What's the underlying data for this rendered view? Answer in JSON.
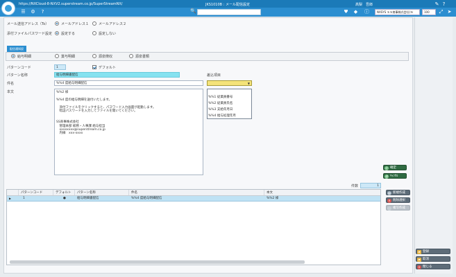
{
  "header": {
    "url": "https://NXCloud-8-NXV2.superstream.co.jp/SuperStreamNX/",
    "title": "JKS1010B : メール配信設定",
    "user": "高梨　吾郎",
    "company": "NXSYS ＳＳ商事株式会社(Ｎ",
    "zoom": "100"
  },
  "form": {
    "mail_to_label": "メール送信アドレス（To）",
    "mail_to_options": [
      "メールアドレス１",
      "メールアドレス２"
    ],
    "password_label": "添付ファイルパスワード設定",
    "password_options": [
      "設定する",
      "設定しない"
    ],
    "section_tag": "配信通知設",
    "delivery_types": [
      "給与明細",
      "賞与明細",
      "源泉徴収",
      "源泉書類"
    ],
    "pattern_code_label": "パターンコード",
    "pattern_code_value": "1",
    "default_label": "デフォルト",
    "pattern_name_label": "パターン名称",
    "pattern_name_value": "給与明細書配信",
    "subject_label": "件名",
    "subject_value": "%%4 度給与明細配信",
    "insert_item_label": "差込項目",
    "body_label": "本文",
    "body_value": "%%2 様\n\n%%4 度の給与明細を送付いたします。\n\n　添付ファイルをクリックすると、パスワード入力画面が起動します。\n　暗証パスワードを入力してファイルを開いてください。\n\n\nSS商事株式会社\n　管理本部 総務・人事課 給与担当\n　xxxxxxxx@superstream.co.jp\n　内線　xxx-xxxx",
    "dropdown_items": [
      "%%1 従業員番号",
      "%%2 従業員氏名",
      "%%3 支給年月日",
      "%%4 給与処理年月"
    ]
  },
  "buttons": {
    "confirm": "確定",
    "cancel": "ｷｬﾝｾﾙ",
    "new_create": "新規作成",
    "delete": "削除選択",
    "copy_create": "複写作成",
    "register": "登録",
    "clear": "取消",
    "close": "閉じる"
  },
  "grid": {
    "count_label": "件数",
    "count_value": "1",
    "headers": [
      "パターンコード",
      "デフォルト",
      "パターン名称",
      "件名",
      "本文"
    ],
    "rows": [
      {
        "code": "1",
        "default": "●",
        "name": "給与明細書配信",
        "subject": "%%4 度給与明細配信",
        "body": "%%2 様"
      }
    ]
  }
}
